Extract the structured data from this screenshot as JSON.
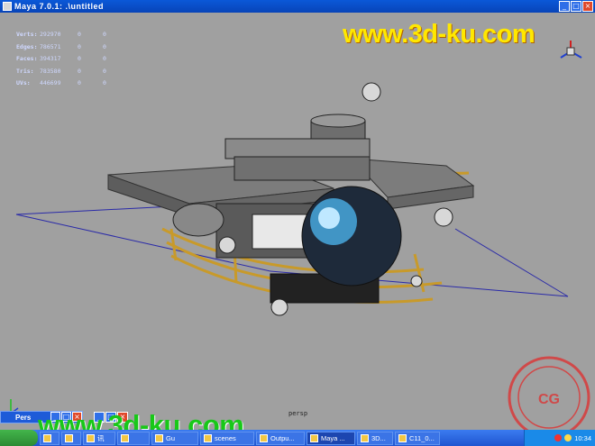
{
  "window": {
    "title": "Maya 7.0.1: .\\untitled",
    "minimize_glyph": "_",
    "maximize_glyph": "□",
    "close_glyph": "×"
  },
  "hud": {
    "rows": [
      {
        "label": "Verts:",
        "value": "292970",
        "a": "0",
        "b": "0"
      },
      {
        "label": "Edges:",
        "value": "786571",
        "a": "0",
        "b": "0"
      },
      {
        "label": "Faces:",
        "value": "394317",
        "a": "0",
        "b": "0"
      },
      {
        "label": "Tris:",
        "value": "783580",
        "a": "0",
        "b": "0"
      },
      {
        "label": "UVs:",
        "value": "446699",
        "a": "0",
        "b": "0"
      }
    ]
  },
  "viewport": {
    "camera_label": "persp",
    "background_color": "#a0a0a0"
  },
  "watermarks": {
    "top": "www.3d-ku.com",
    "bottom": "www.3d-ku.com",
    "stamp_text": "CG模型网"
  },
  "mini_window": {
    "title": "Pers"
  },
  "taskbar": {
    "tasks": [
      {
        "label": "",
        "active": false
      },
      {
        "label": "",
        "active": false
      },
      {
        "label": "讯",
        "active": false
      },
      {
        "label": "",
        "active": false
      },
      {
        "label": "Gu",
        "active": false
      },
      {
        "label": "scenes",
        "active": false
      },
      {
        "label": "Outpu...",
        "active": false
      },
      {
        "label": "Maya ...",
        "active": true
      },
      {
        "label": "3D...",
        "active": false
      },
      {
        "label": "C11_0...",
        "active": false
      }
    ],
    "clock": "10:34"
  },
  "colors": {
    "title_bar": "#0a58d8",
    "taskbar": "#2a62dc",
    "hud_text": "#cfd8ff",
    "watermark_top": "#ffe800",
    "watermark_bottom": "#18c818",
    "stamp": "#d83a3a"
  },
  "icons": {
    "title": "maya-app-icon",
    "axis": "axis-gizmo-icon",
    "view_cube": "view-cube-icon",
    "start": "start-button-icon"
  }
}
